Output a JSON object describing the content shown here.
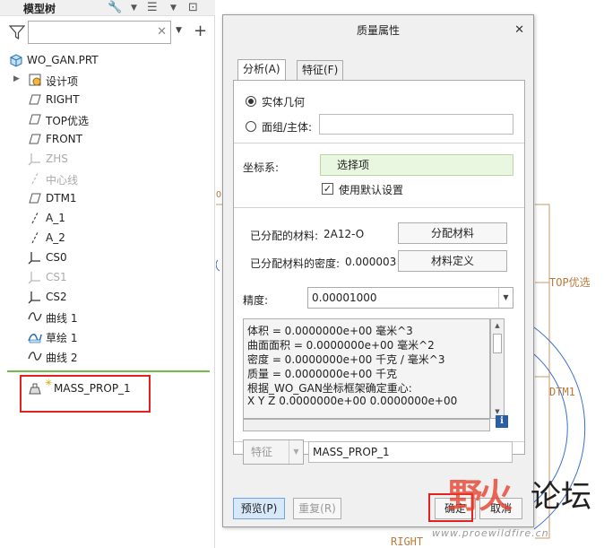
{
  "tree": {
    "title": "模型树",
    "search": {
      "value": "",
      "placeholder": ""
    },
    "root": "WO_GAN.PRT",
    "items": [
      {
        "label": "设计项",
        "icon": "design-items-icon"
      },
      {
        "label": "RIGHT",
        "icon": "datum-plane-icon"
      },
      {
        "label": "TOP优选",
        "icon": "datum-plane-icon"
      },
      {
        "label": "FRONT",
        "icon": "datum-plane-icon"
      },
      {
        "label": "ZHS",
        "icon": "coord-system-icon",
        "dim": true
      },
      {
        "label": "中心线",
        "icon": "axis-icon",
        "dim": true
      },
      {
        "label": "DTM1",
        "icon": "datum-plane-icon"
      },
      {
        "label": "A_1",
        "icon": "axis-icon"
      },
      {
        "label": "A_2",
        "icon": "axis-icon"
      },
      {
        "label": "CS0",
        "icon": "coord-system-icon"
      },
      {
        "label": "CS1",
        "icon": "coord-system-icon",
        "dim": true
      },
      {
        "label": "CS2",
        "icon": "coord-system-icon"
      },
      {
        "label": "曲线 1",
        "icon": "curve-icon"
      },
      {
        "label": "草绘 1",
        "icon": "sketch-icon"
      },
      {
        "label": "曲线 2",
        "icon": "curve-icon"
      }
    ],
    "new_feature": "MASS_PROP_1"
  },
  "canvas": {
    "labels": {
      "top": "TOP优选",
      "dtm": "DTM1",
      "right": "RIGHT"
    }
  },
  "dialog": {
    "title": "质量属性",
    "tabs": [
      "分析(A)",
      "特征(F)"
    ],
    "radio_solid": "实体几何",
    "radio_quilt": "面组/主体:",
    "quilt_value": "",
    "csys_label": "坐标系:",
    "csys_value": "选择项",
    "default_setting": "使用默认设置",
    "material_label": "已分配的材料:",
    "material_value": "2A12-O",
    "assign_material": "分配材料",
    "density_label": "已分配材料的密度:",
    "density_value": "0.000003",
    "define_material": "材料定义",
    "precision_label": "精度:",
    "precision_value": "0.00001000",
    "results": [
      "体积 =  0.0000000e+00  毫米^3",
      "曲面面积 =  0.0000000e+00  毫米^2",
      "密度 =  0.0000000e+00 千克 / 毫米^3",
      "质量 =  0.0000000e+00 千克",
      "根据_WO_GAN坐标框架确定重心:",
      "X   Y   Z      0.0000000e+00  0.0000000e+00"
    ],
    "feature_type": "特征",
    "feature_name": "MASS_PROP_1",
    "preview": "预览(P)",
    "repeat": "重复(R)",
    "ok": "确定",
    "cancel": "取消"
  },
  "watermark": {
    "logo": "野火",
    "text": "论坛",
    "url": "www.proewildfire.cn"
  },
  "colors": {
    "accent_red": "#e52020",
    "tree_separator": "#6cc04a",
    "datum_orange": "#b97a3c",
    "csys_field": "#eaf7e0"
  }
}
